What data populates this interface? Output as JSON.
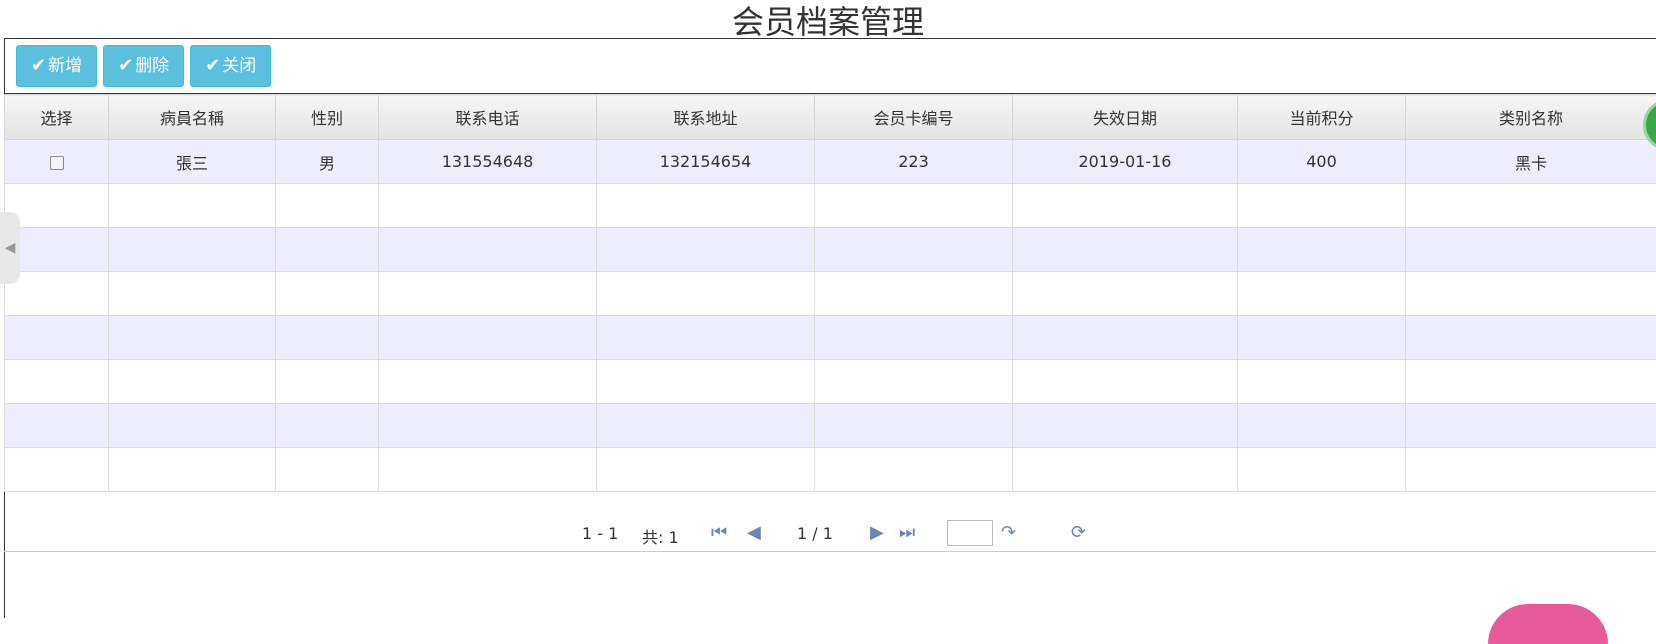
{
  "title": "会员档案管理",
  "toolbar": {
    "add_label": "新增",
    "delete_label": "删除",
    "close_label": "关闭"
  },
  "table": {
    "columns": [
      "选择",
      "病員名稱",
      "性别",
      "联系电话",
      "联系地址",
      "会员卡编号",
      "失效日期",
      "当前积分",
      "类别名称"
    ],
    "rows": [
      [
        "",
        "張三",
        "男",
        "131554648",
        "132154654",
        "223",
        "2019-01-16",
        "400",
        "黑卡"
      ]
    ]
  },
  "pager": {
    "range": "1 - 1",
    "total": "共: 1",
    "page": "1 / 1",
    "page_input_value": ""
  },
  "colors": {
    "button_bg": "#5bc0de",
    "row_alt_bg": "#ededfc",
    "pager_icon": "#6b86b8"
  }
}
